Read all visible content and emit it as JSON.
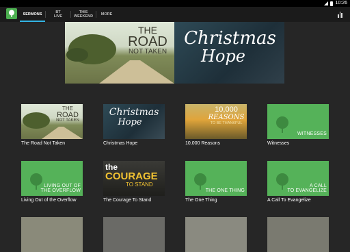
{
  "status_bar": {
    "time": "10:26"
  },
  "tabs": [
    {
      "label": "SERMONS"
    },
    {
      "label": "BT\nLIVE"
    },
    {
      "label": "THIS\nWEEKEND"
    },
    {
      "label": "MORE"
    }
  ],
  "hero": [
    {
      "line1": "THE",
      "line2": "ROAD",
      "line3": "NOT TAKEN"
    },
    {
      "line1": "Christmas",
      "line2": "Hope"
    }
  ],
  "sermons": [
    {
      "title": "The Road Not Taken",
      "art": {
        "line1": "THE",
        "line2": "ROAD",
        "line3": "NOT TAKEN"
      }
    },
    {
      "title": "Christmas Hope",
      "art": {
        "line1": "Christmas",
        "line2": "Hope"
      }
    },
    {
      "title": "10,000 Reasons",
      "art": {
        "line1": "10,000",
        "line2": "REASONS",
        "line3": "TO BE THANKFUL"
      }
    },
    {
      "title": "Witnesses",
      "art": {
        "line1": "WITNESSES"
      }
    },
    {
      "title": "Living Out of the Overflow",
      "art": {
        "line1": "LIVING OUT OF",
        "line2": "THE OVERFLOW"
      }
    },
    {
      "title": "The Courage To Stand",
      "art": {
        "line1": "the",
        "line2": "COURAGE",
        "line3": "TO STAND"
      }
    },
    {
      "title": "The One Thing",
      "art": {
        "line1": "THE ONE THING"
      }
    },
    {
      "title": "A Call To Evangelize",
      "art": {
        "line1": "A CALL",
        "line2": "TO EVANGELIZE"
      }
    }
  ],
  "colors": {
    "accent": "#33b5e5",
    "brand_green": "#55b259",
    "background": "#262626"
  }
}
